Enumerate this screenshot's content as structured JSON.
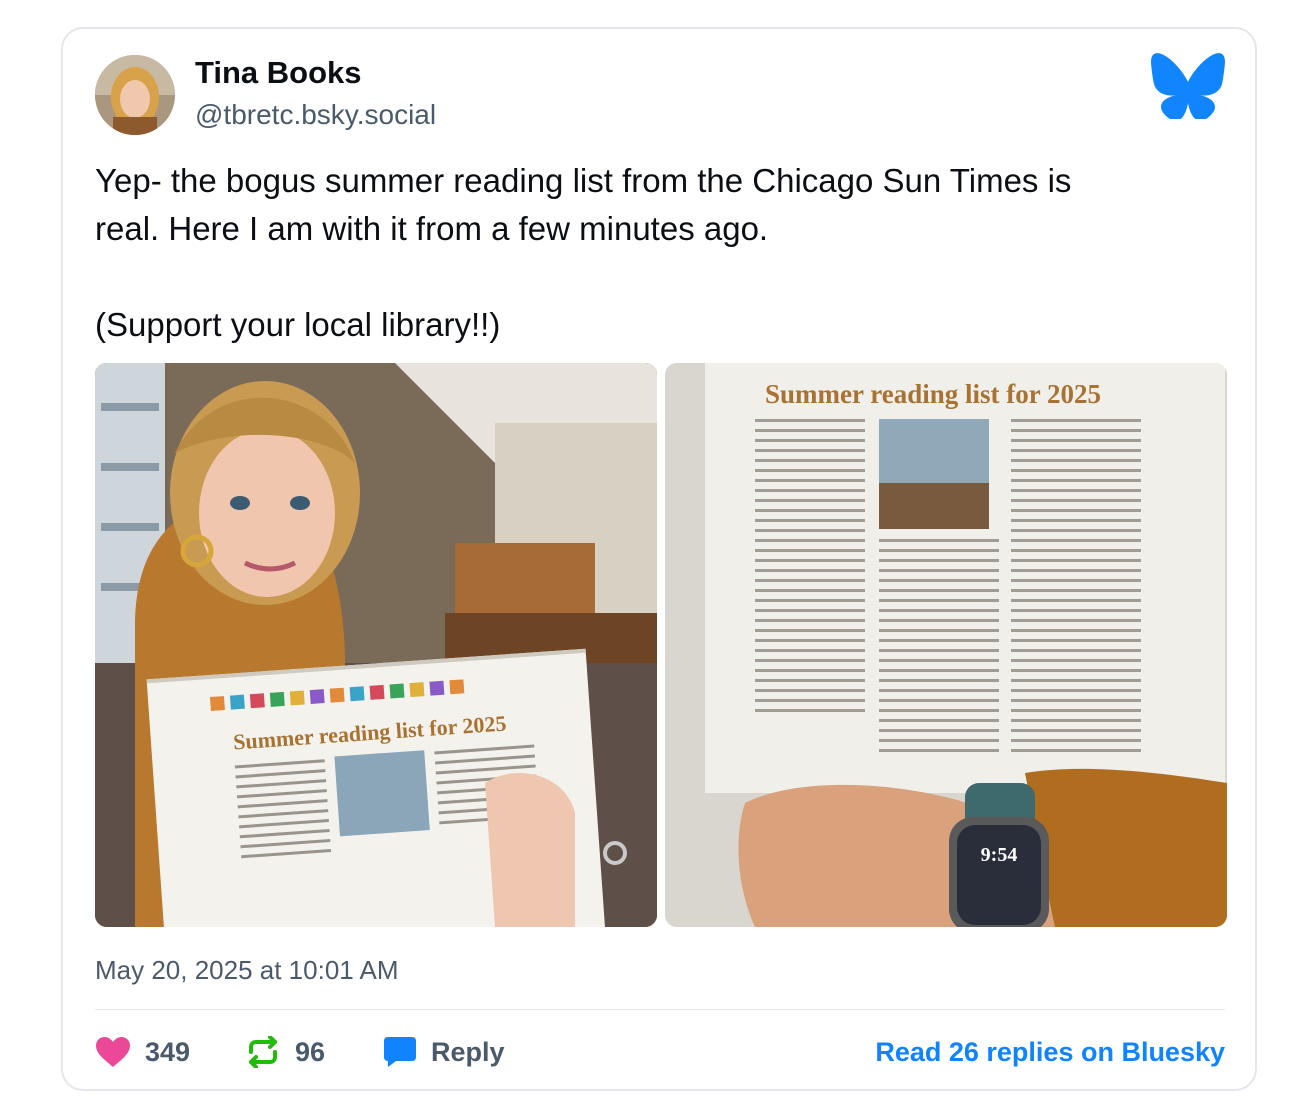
{
  "post": {
    "author_name": "Tina Books",
    "author_handle": "@tbretc.bsky.social",
    "text_line1": "Yep- the bogus summer reading list from the Chicago Sun Times is",
    "text_line2": "real. Here I am with it from a few minutes ago.",
    "text_line3": "(Support your local library!!)",
    "timestamp": "May 20, 2025 at 10:01 AM",
    "icons": {
      "logo": "bluesky-butterfly-icon",
      "like": "heart-icon",
      "repost": "repost-icon",
      "reply": "reply-bubble-icon"
    },
    "colors": {
      "brand": "#1185fe",
      "like": "#ec4899",
      "repost": "#20bc07",
      "link": "#1083fe",
      "muted": "#4b5a6a"
    }
  },
  "images": {
    "left": {
      "headline": "Summer reading list for 2025"
    },
    "right": {
      "headline": "Summer reading list for 2025",
      "watch_time": "9:54"
    }
  },
  "stats": {
    "likes": "349",
    "reposts": "96",
    "reply_label": "Reply",
    "read_more": "Read 26 replies on Bluesky"
  }
}
